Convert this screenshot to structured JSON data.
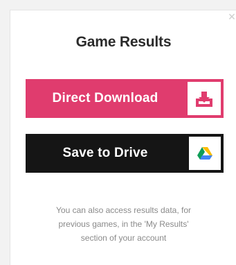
{
  "dialog": {
    "close_icon": "close-icon",
    "title": "Game Results"
  },
  "buttons": {
    "download": {
      "label": "Direct Download",
      "icon": "download-icon",
      "color": "#e03c6e"
    },
    "drive": {
      "label": "Save to Drive",
      "icon": "google-drive-icon",
      "color": "#151515"
    }
  },
  "note": {
    "lines": [
      "You can also access results data, for",
      "previous games, in the 'My Results'",
      "section of your account"
    ]
  }
}
